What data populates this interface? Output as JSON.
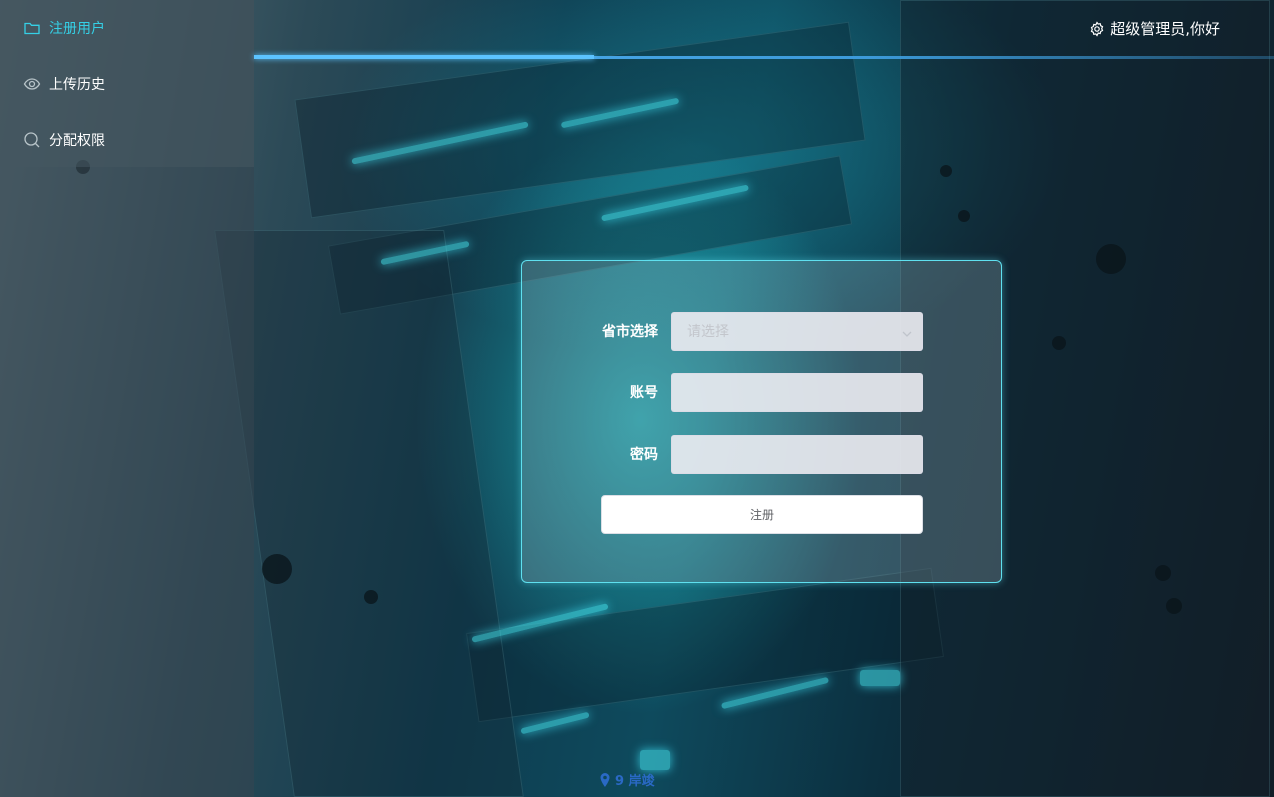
{
  "sidebar": {
    "items": [
      {
        "label": "注册用户",
        "icon": "folder-icon",
        "active": true
      },
      {
        "label": "上传历史",
        "icon": "eye-icon",
        "active": false
      },
      {
        "label": "分配权限",
        "icon": "search-icon",
        "active": false
      }
    ]
  },
  "header": {
    "greeting": "超级管理员,你好",
    "icon": "gear-icon"
  },
  "form": {
    "province_label": "省市选择",
    "province_placeholder": "请选择",
    "account_label": "账号",
    "account_value": "",
    "password_label": "密码",
    "password_value": "",
    "submit_label": "注册"
  },
  "footer": {
    "mark_text": "9 岸竣"
  },
  "colors": {
    "accent": "#35d0e6",
    "card_border": "#5fe0ef",
    "header_line": "#49a8e8"
  }
}
